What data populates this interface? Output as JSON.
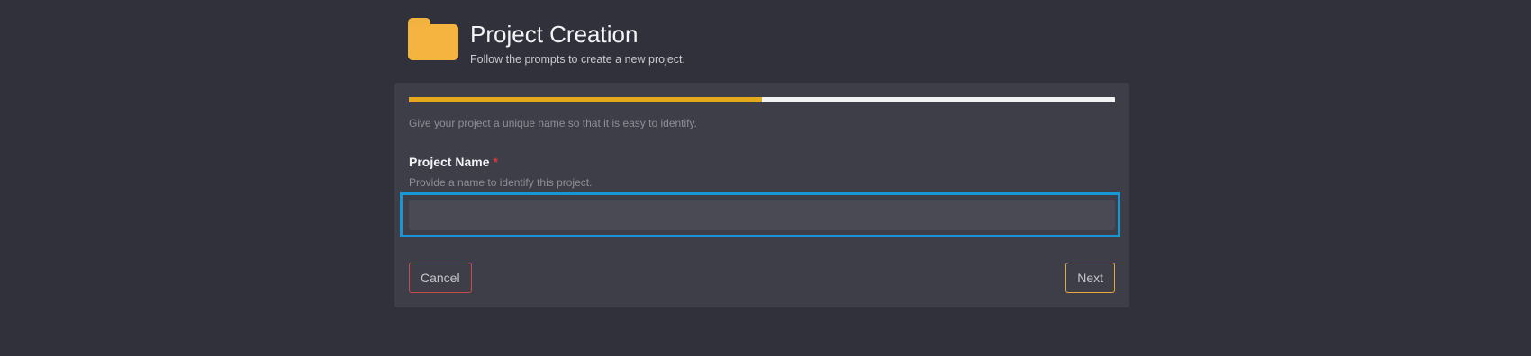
{
  "header": {
    "title": "Project Creation",
    "subtitle": "Follow the prompts to create a new project.",
    "icon": "folder-icon",
    "icon_color": "#f4b43f"
  },
  "wizard": {
    "progress_fraction": 0.5,
    "progress_color": "#e6a81d",
    "intro": "Give your project a unique name so that it is easy to identify.",
    "field": {
      "label": "Project Name",
      "required_marker": "*",
      "help": "Provide a name to identify this project.",
      "value": "",
      "placeholder": ""
    },
    "buttons": {
      "cancel_label": "Cancel",
      "next_label": "Next"
    }
  },
  "colors": {
    "background": "#30313b",
    "card": "#3e3e48",
    "focus_ring": "#1797d4",
    "cancel_border": "#c84a4a",
    "next_border": "#e4a83c"
  }
}
